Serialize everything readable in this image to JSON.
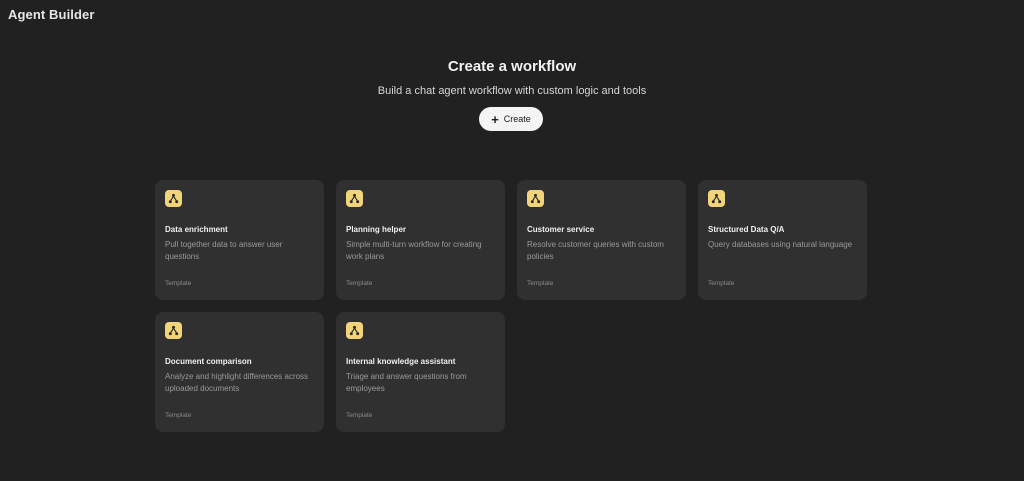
{
  "app": {
    "title": "Agent Builder"
  },
  "hero": {
    "title": "Create a workflow",
    "subtitle": "Build a chat agent workflow with custom logic and tools",
    "create_label": "Create",
    "create_icon": "plus-icon"
  },
  "colors": {
    "background": "#212121",
    "card": "#303030",
    "icon_accent": "#f2d47a"
  },
  "templates": [
    {
      "title": "Data enrichment",
      "description": "Pull together data to answer user questions",
      "tag": "Template",
      "icon": "workflow-icon"
    },
    {
      "title": "Planning helper",
      "description": "Simple multi-turn workflow for creating work plans",
      "tag": "Template",
      "icon": "workflow-icon"
    },
    {
      "title": "Customer service",
      "description": "Resolve customer queries with custom policies",
      "tag": "Template",
      "icon": "workflow-icon"
    },
    {
      "title": "Structured Data Q/A",
      "description": "Query databases using natural language",
      "tag": "Template",
      "icon": "workflow-icon"
    },
    {
      "title": "Document comparison",
      "description": "Analyze and highlight differences across uploaded documents",
      "tag": "Template",
      "icon": "workflow-icon"
    },
    {
      "title": "Internal knowledge assistant",
      "description": "Triage and answer questions from employees",
      "tag": "Template",
      "icon": "workflow-icon"
    }
  ]
}
